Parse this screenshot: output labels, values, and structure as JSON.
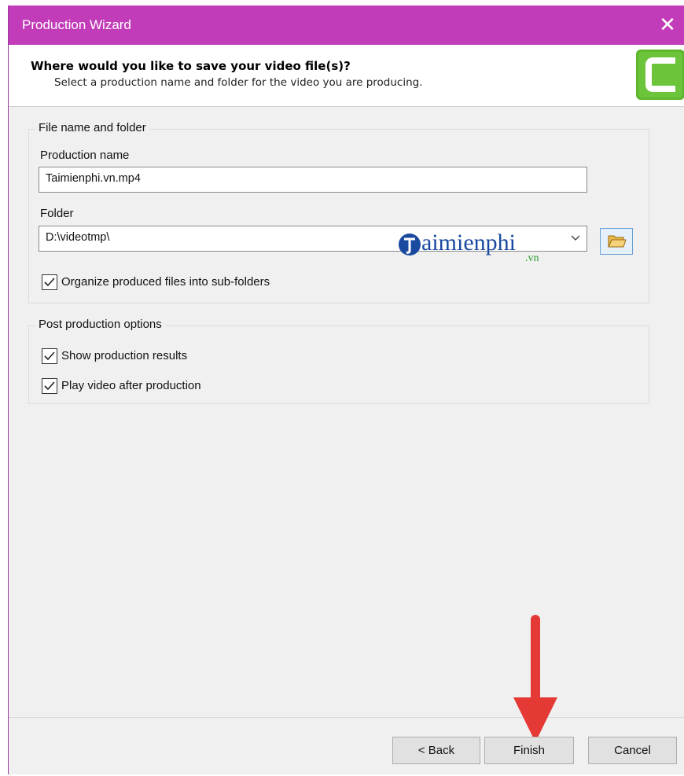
{
  "window": {
    "title": "Production Wizard",
    "close_glyph": "✕"
  },
  "header": {
    "title": "Where would you like to save your video file(s)?",
    "subtitle": "Select a production name and folder for the video you are producing."
  },
  "file_group": {
    "title": "File name and folder",
    "production_name_label": "Production name",
    "production_name_value": "Taimienphi.vn.mp4",
    "folder_label": "Folder",
    "folder_value": "D:\\videotmp\\",
    "organize_label": "Organize produced files into sub-folders",
    "organize_checked": true
  },
  "post_group": {
    "title": "Post production options",
    "show_results_label": "Show production results",
    "show_results_checked": true,
    "play_video_label": "Play video after production",
    "play_video_checked": true
  },
  "watermark": {
    "text": "aimienphi",
    "suffix": ".vn"
  },
  "buttons": {
    "back": "< Back",
    "finish": "Finish",
    "cancel": "Cancel"
  },
  "colors": {
    "titlebar": "#c23cb9",
    "logo_green": "#5fb72f",
    "annotation_arrow": "#e53935"
  },
  "icons": [
    "close-icon",
    "camtasia-logo-icon",
    "folder-open-icon",
    "chevron-down-icon",
    "checkmark-icon",
    "red-arrow-annotation"
  ]
}
